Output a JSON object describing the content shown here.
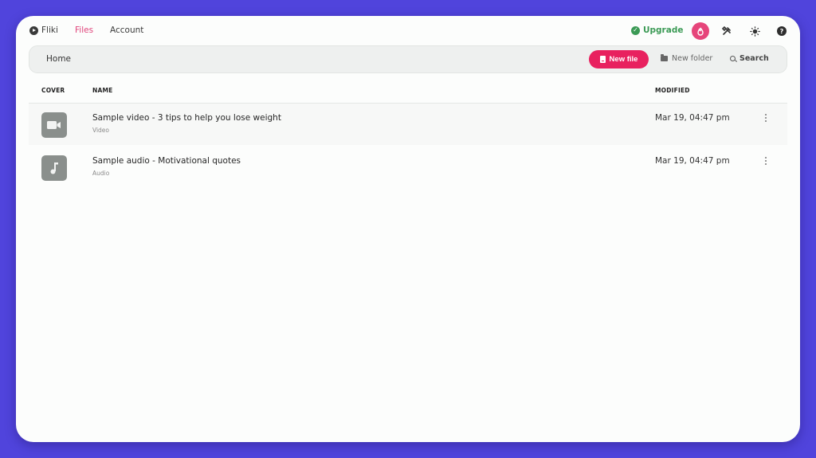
{
  "nav": {
    "brand": "Fliki",
    "items": [
      {
        "label": "Files",
        "active": true
      },
      {
        "label": "Account",
        "active": false
      }
    ],
    "upgrade_label": "Upgrade",
    "icons": [
      "flame-icon",
      "tools-icon",
      "brightness-icon",
      "help-icon"
    ]
  },
  "toolbar": {
    "breadcrumb": "Home",
    "new_file_label": "New file",
    "new_folder_label": "New folder",
    "search_label": "Search"
  },
  "table": {
    "columns": [
      "COVER",
      "NAME",
      "MODIFIED"
    ],
    "rows": [
      {
        "title": "Sample video - 3 tips to help you lose weight",
        "type": "Video",
        "modified": "Mar 19, 04:47 pm",
        "icon": "video-camera-icon"
      },
      {
        "title": "Sample audio - Motivational quotes",
        "type": "Audio",
        "modified": "Mar 19, 04:47 pm",
        "icon": "music-note-icon"
      }
    ]
  },
  "colors": {
    "background": "#5044dc",
    "accent": "#e8215f",
    "active_nav": "#e0457b",
    "upgrade": "#3b9a55"
  }
}
